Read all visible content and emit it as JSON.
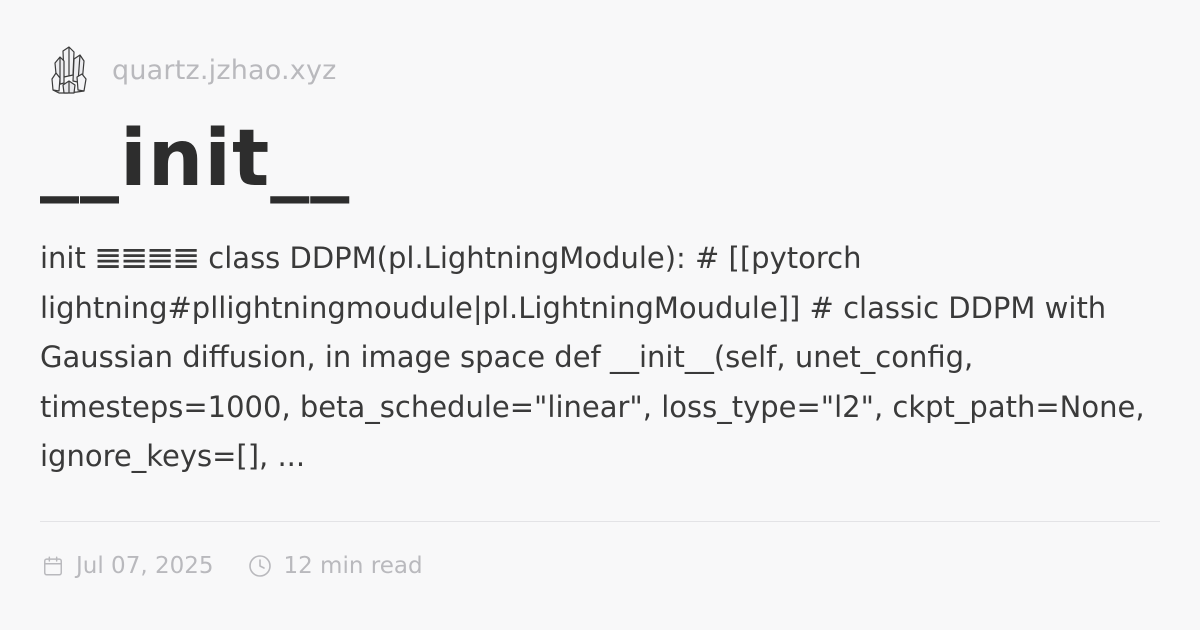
{
  "site": {
    "name": "quartz.jzhao.xyz",
    "logo_icon": "crystal-logo-icon"
  },
  "page": {
    "title": "__init__",
    "description": "init 𝌆𝌆𝌆𝌆 class DDPM(pl.LightningModule): # [[pytorch lightning#pllightningmoudule|pl.LightningMoudule]] # classic DDPM with Gaussian diffusion, in image space def __init__(self, unet_config, timesteps=1000, beta_schedule=\"linear\", loss_type=\"l2\", ckpt_path=None, ignore_keys=[], ..."
  },
  "meta": {
    "date": "Jul 07, 2025",
    "date_icon": "calendar-icon",
    "read_time": "12 min read",
    "read_time_icon": "clock-icon"
  },
  "colors": {
    "background": "#f8f8f9",
    "text": "#2d2d2d",
    "muted": "#b9b9bd",
    "divider": "#e3e3e6"
  }
}
